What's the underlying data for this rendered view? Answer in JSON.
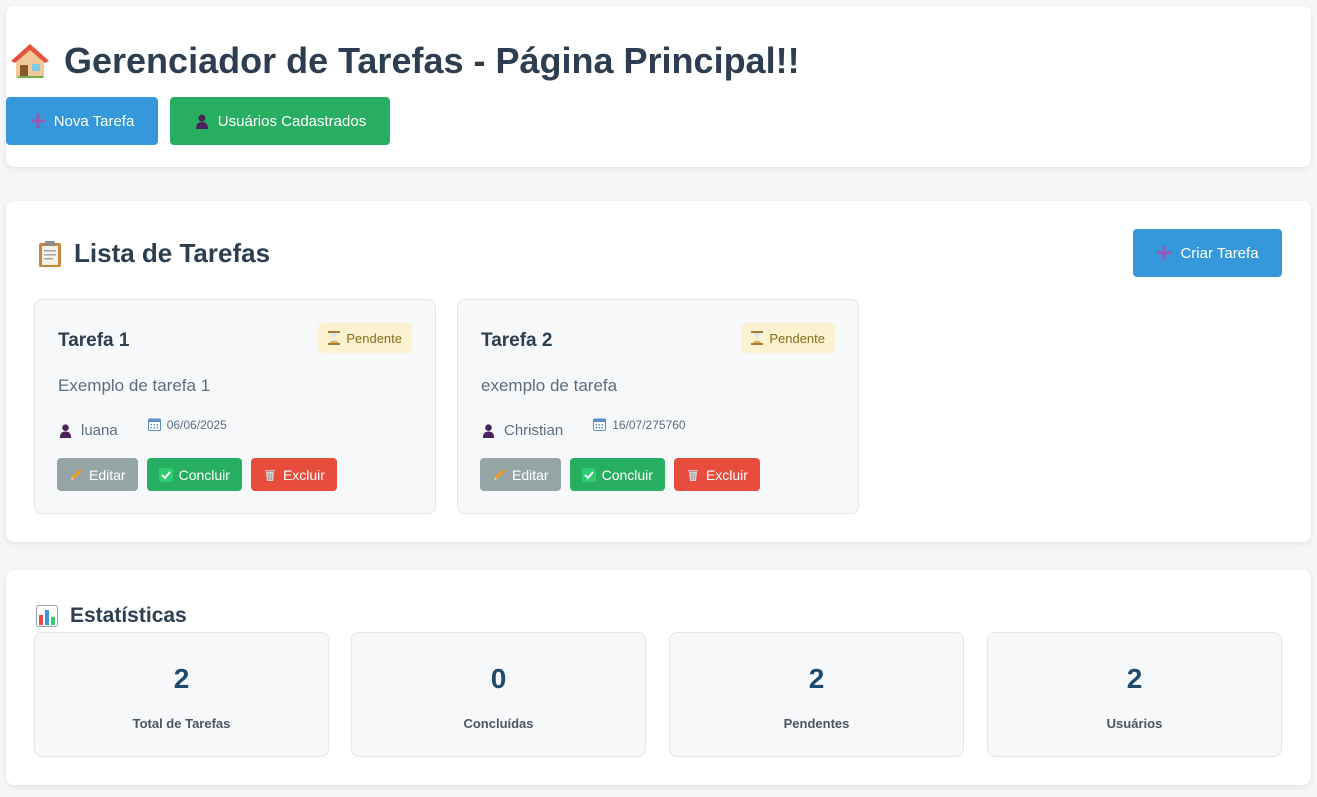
{
  "header": {
    "title": "Gerenciador de Tarefas - Página Principal!!",
    "title_icon": "house-icon",
    "buttons": {
      "new_task": "Nova Tarefa",
      "users": "Usuários Cadastrados"
    }
  },
  "task_list": {
    "title": "Lista de Tarefas",
    "title_icon": "clipboard-icon",
    "create_button": "Criar Tarefa",
    "tasks": [
      {
        "name": "Tarefa 1",
        "status": "Pendente",
        "description": "Exemplo de tarefa 1",
        "user": "luana",
        "date": "06/06/2025",
        "actions": {
          "edit": "Editar",
          "complete": "Concluir",
          "delete": "Excluir"
        }
      },
      {
        "name": "Tarefa 2",
        "status": "Pendente",
        "description": "exemplo de tarefa",
        "user": "Christian",
        "date": "16/07/275760",
        "actions": {
          "edit": "Editar",
          "complete": "Concluir",
          "delete": "Excluir"
        }
      }
    ]
  },
  "stats": {
    "title": "Estatísticas",
    "title_icon": "bar-chart-icon",
    "items": [
      {
        "value": "2",
        "label": "Total de Tarefas"
      },
      {
        "value": "0",
        "label": "Concluídas"
      },
      {
        "value": "2",
        "label": "Pendentes"
      },
      {
        "value": "2",
        "label": "Usuários"
      }
    ]
  },
  "colors": {
    "primary": "#3498db",
    "success": "#27ae60",
    "danger": "#e74c3c",
    "neutral": "#95a5a6",
    "pending_badge": "#fdf2cf",
    "title_text": "#2c3e50"
  }
}
